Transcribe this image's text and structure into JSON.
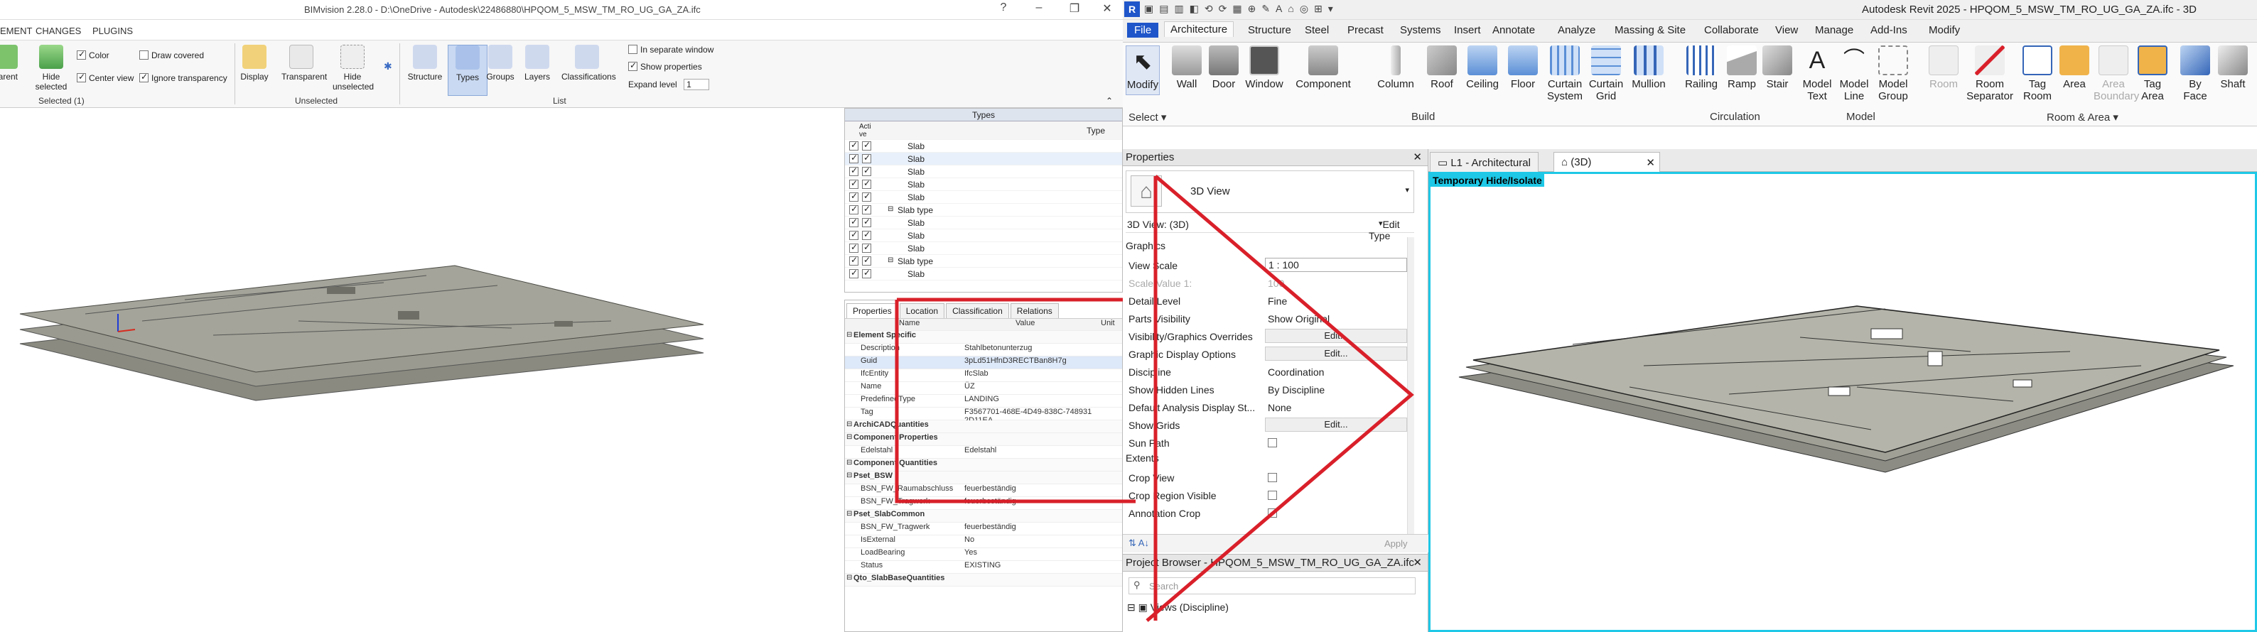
{
  "bimvision": {
    "title": "BIMvision 2.28.0 - D:\\OneDrive - Autodesk\\22486880\\HPQOM_5_MSW_TM_RO_UG_GA_ZA.ifc",
    "menu": [
      "EMENT",
      "CHANGES",
      "PLUGINS"
    ],
    "ribbon": {
      "selected": {
        "buttons": [
          "parent",
          "Hide selected"
        ],
        "checks": [
          {
            "label": "Color",
            "checked": true
          },
          {
            "label": "Draw covered",
            "checked": false
          },
          {
            "label": "Center view",
            "checked": true
          },
          {
            "label": "Ignore transparency",
            "checked": true
          }
        ],
        "group_label": "Selected (1)"
      },
      "unselected": {
        "buttons": [
          "Display",
          "Transparent",
          "Hide unselected"
        ],
        "group_label": "Unselected"
      },
      "list": {
        "buttons": [
          "Structure",
          "Types",
          "Groups",
          "Layers",
          "Classifications"
        ],
        "checks": [
          {
            "label": "In separate window",
            "checked": false
          },
          {
            "label": "Show properties",
            "checked": true
          }
        ],
        "expand_label": "Expand level",
        "expand_value": "1",
        "group_label": "List"
      }
    },
    "types_panel": {
      "title": "Types",
      "col_active": "Acti ve",
      "col_type": "Type",
      "rows": [
        {
          "indent": 1,
          "label": "Slab"
        },
        {
          "indent": 1,
          "label": "Slab"
        },
        {
          "indent": 1,
          "label": "Slab"
        },
        {
          "indent": 1,
          "label": "Slab"
        },
        {
          "indent": 1,
          "label": "Slab"
        },
        {
          "indent": 0,
          "label": "Slab type"
        },
        {
          "indent": 1,
          "label": "Slab"
        },
        {
          "indent": 1,
          "label": "Slab"
        },
        {
          "indent": 1,
          "label": "Slab"
        },
        {
          "indent": 0,
          "label": "Slab type"
        },
        {
          "indent": 1,
          "label": "Slab"
        }
      ]
    },
    "properties_panel": {
      "tabs": [
        "Properties",
        "Location",
        "Classification",
        "Relations"
      ],
      "columns": [
        "Name",
        "Value",
        "Unit"
      ],
      "rows": [
        {
          "section": true,
          "name": "Element Specific",
          "value": ""
        },
        {
          "section": false,
          "name": "Description",
          "value": "Stahlbetonunterzug"
        },
        {
          "section": false,
          "name": "Guid",
          "value": "3pLd51HfnD3RECTBan8H7g"
        },
        {
          "section": false,
          "name": "IfcEntity",
          "value": "IfcSlab"
        },
        {
          "section": false,
          "name": "Name",
          "value": "ÜZ"
        },
        {
          "section": false,
          "name": "PredefinedType",
          "value": "LANDING"
        },
        {
          "section": false,
          "name": "Tag",
          "value": "F3567701-468E-4D49-838C-748931 2D11EA"
        },
        {
          "section": true,
          "name": "ArchiCADQuantities",
          "value": ""
        },
        {
          "section": true,
          "name": "Component Properties",
          "value": ""
        },
        {
          "section": false,
          "name": "Edelstahl",
          "value": "Edelstahl"
        },
        {
          "section": true,
          "name": "Component Quantities",
          "value": ""
        },
        {
          "section": true,
          "name": "Pset_BSW",
          "value": ""
        },
        {
          "section": false,
          "name": "BSN_FW_Raumabschluss",
          "value": "feuerbeständig"
        },
        {
          "section": false,
          "name": "BSN_FW_Tragwerk",
          "value": "feuerbeständig"
        },
        {
          "section": true,
          "name": "Pset_SlabCommon",
          "value": ""
        },
        {
          "section": false,
          "name": "BSN_FW_Tragwerk",
          "value": "feuerbeständig"
        },
        {
          "section": false,
          "name": "IsExternal",
          "value": "No"
        },
        {
          "section": false,
          "name": "LoadBearing",
          "value": "Yes"
        },
        {
          "section": false,
          "name": "Status",
          "value": "EXISTING"
        },
        {
          "section": true,
          "name": "Qto_SlabBaseQuantities",
          "value": ""
        }
      ]
    }
  },
  "revit": {
    "title": "Autodesk Revit 2025 - HPQOM_5_MSW_TM_RO_UG_GA_ZA.ifc - 3D",
    "tabs": [
      "File",
      "Architecture",
      "Structure",
      "Steel",
      "Precast",
      "Systems",
      "Insert",
      "Annotate",
      "Analyze",
      "Massing & Site",
      "Collaborate",
      "View",
      "Manage",
      "Add-Ins",
      "Modify"
    ],
    "active_tab": "Architecture",
    "ribbon": {
      "select": {
        "button": "Modify",
        "group": "Select"
      },
      "build": {
        "buttons": [
          "Wall",
          "Door",
          "Window",
          "Component",
          "Column",
          "Roof",
          "Ceiling",
          "Floor",
          "Curtain System",
          "Curtain Grid",
          "Mullion"
        ],
        "group": "Build"
      },
      "circulation": {
        "buttons": [
          "Railing",
          "Ramp",
          "Stair"
        ],
        "group": "Circulation"
      },
      "model": {
        "buttons": [
          "Model Text",
          "Model Line",
          "Model Group"
        ],
        "group": "Model"
      },
      "room_area": {
        "buttons": [
          "Room",
          "Room Separator",
          "Tag Room",
          "Area",
          "Area Boundary",
          "Tag Area"
        ],
        "group": "Room & Area"
      },
      "opening": {
        "buttons": [
          "By Face",
          "Shaft"
        ]
      }
    },
    "properties": {
      "title": "Properties",
      "type_name": "3D View",
      "instance_label": "3D View: (3D)",
      "edit_type": "Edit Type",
      "sections": [
        {
          "name": "Graphics",
          "rows": [
            {
              "name": "View Scale",
              "value": "1 : 100",
              "kind": "input"
            },
            {
              "name": "Scale Value    1:",
              "value": "100",
              "kind": "disabled"
            },
            {
              "name": "Detail Level",
              "value": "Fine",
              "kind": "text"
            },
            {
              "name": "Parts Visibility",
              "value": "Show Original",
              "kind": "text"
            },
            {
              "name": "Visibility/Graphics Overrides",
              "value": "Edit...",
              "kind": "button"
            },
            {
              "name": "Graphic Display Options",
              "value": "Edit...",
              "kind": "button"
            },
            {
              "name": "Discipline",
              "value": "Coordination",
              "kind": "text"
            },
            {
              "name": "Show Hidden Lines",
              "value": "By Discipline",
              "kind": "text"
            },
            {
              "name": "Default Analysis Display St...",
              "value": "None",
              "kind": "text"
            },
            {
              "name": "Show Grids",
              "value": "Edit...",
              "kind": "button"
            },
            {
              "name": "Sun Path",
              "value": "",
              "kind": "check"
            }
          ]
        },
        {
          "name": "Extents",
          "rows": [
            {
              "name": "Crop View",
              "value": "",
              "kind": "check"
            },
            {
              "name": "Crop Region Visible",
              "value": "",
              "kind": "check"
            },
            {
              "name": "Annotation Crop",
              "value": "",
              "kind": "check"
            }
          ]
        }
      ],
      "apply": "Apply"
    },
    "project_browser": {
      "title": "Project Browser - HPQOM_5_MSW_TM_RO_UG_GA_ZA.ifc",
      "search_placeholder": "Search",
      "root": "Views (Discipline)"
    },
    "doc_tabs": [
      "L1 - Architectural",
      "(3D)"
    ],
    "active_doc_tab": "(3D)",
    "view_banner": "Temporary Hide/Isolate"
  },
  "annotation": {
    "color": "#d9202a"
  }
}
